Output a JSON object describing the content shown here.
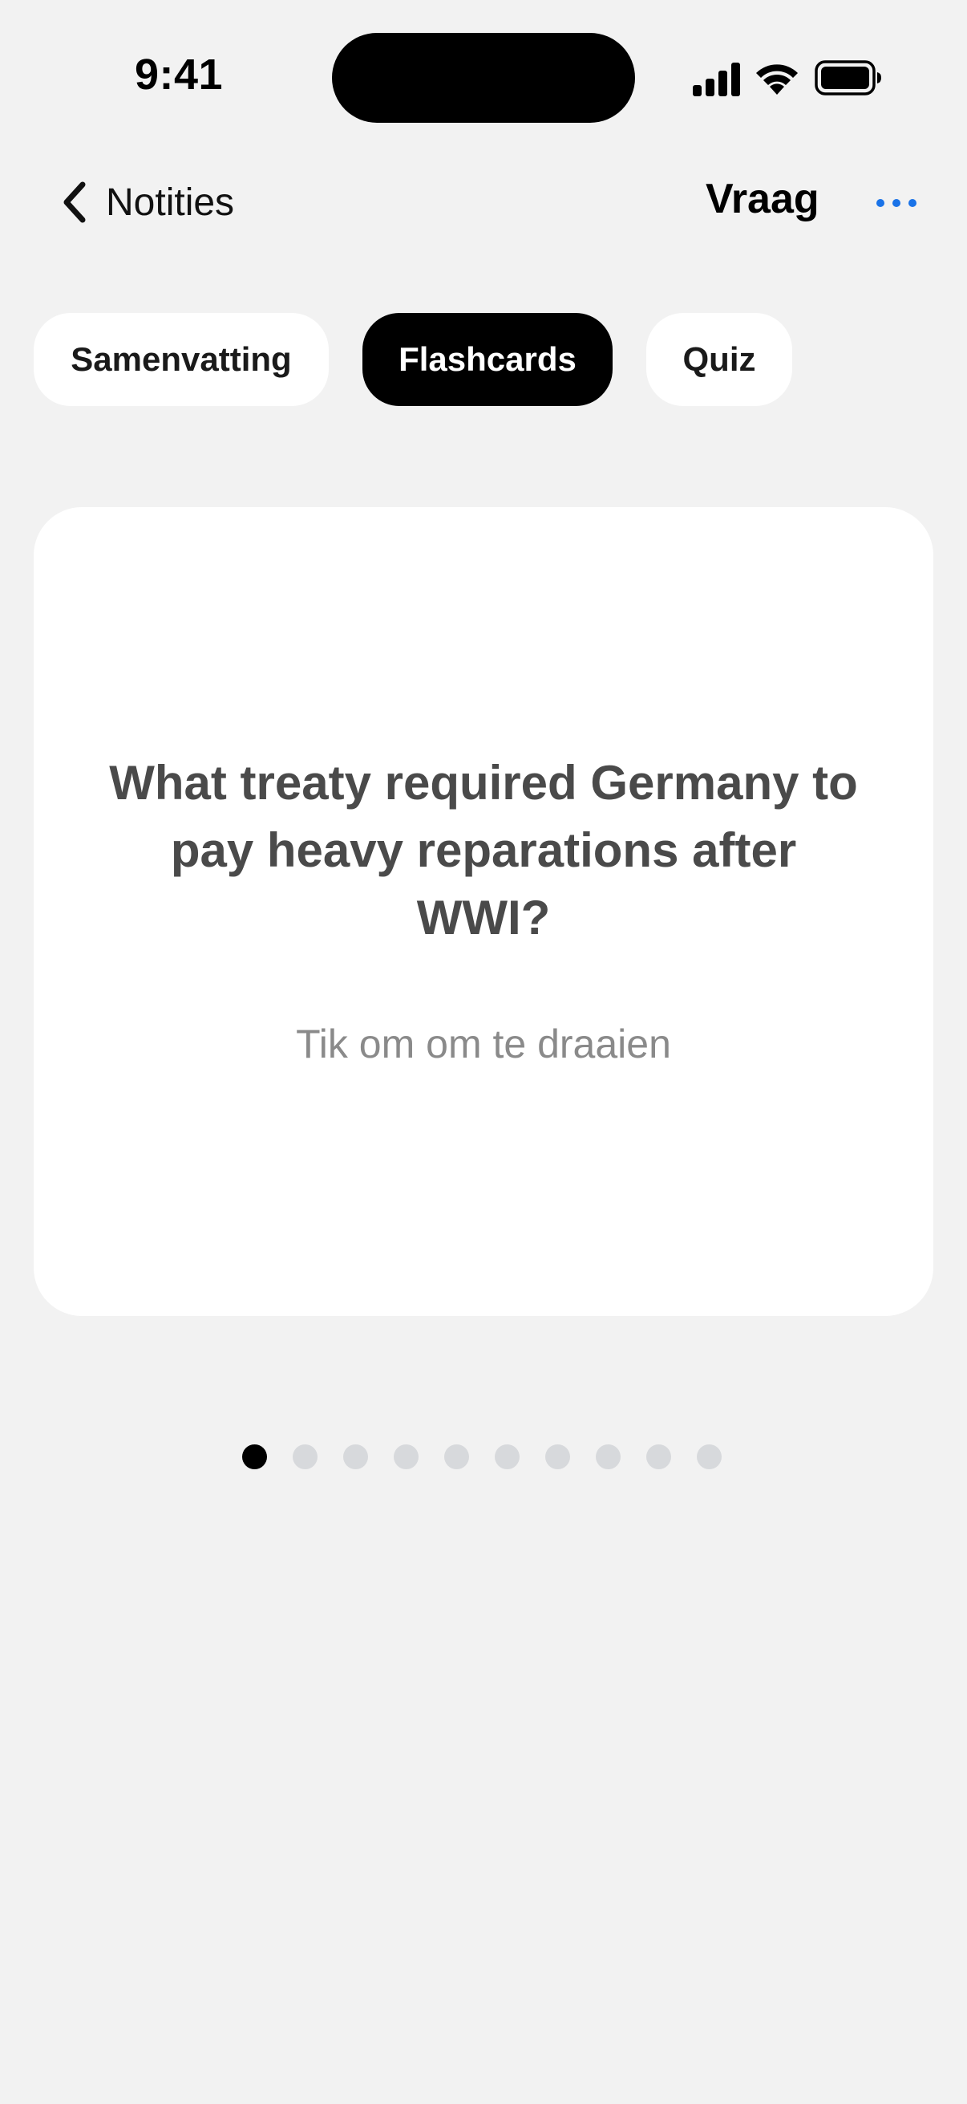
{
  "status_bar": {
    "time": "9:41",
    "icons": [
      "cellular-signal-icon",
      "wifi-icon",
      "battery-icon"
    ]
  },
  "nav": {
    "back_label": "Notities",
    "back_icon": "chevron-left-icon",
    "title": "Vraag",
    "more_icon": "ellipsis-icon",
    "accent_color": "#1a73e8"
  },
  "tabs": [
    {
      "label": "Samenvatting",
      "active": false
    },
    {
      "label": "Flashcards",
      "active": true
    },
    {
      "label": "Quiz",
      "active": false
    }
  ],
  "flashcard": {
    "question": "What treaty required Germany to pay heavy reparations after WWI?",
    "hint": "Tik om om te draaien"
  },
  "pager": {
    "total": 10,
    "current": 1
  },
  "colors": {
    "background": "#f2f2f2",
    "card": "#ffffff",
    "active_tab": "#000000",
    "dot_inactive": "#d7d9dc",
    "dot_active": "#000000"
  }
}
